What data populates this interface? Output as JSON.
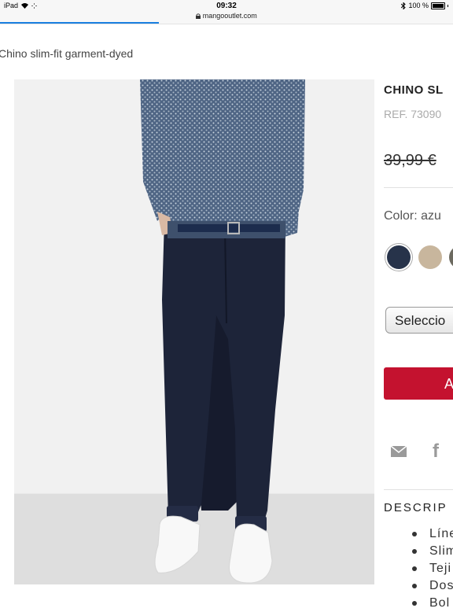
{
  "status_bar": {
    "device": "iPad",
    "time": "09:32",
    "url": "mangooutlet.com",
    "battery": "100 %",
    "load_progress": 0.35
  },
  "breadcrumb": "Chino slim-fit garment-dyed",
  "product": {
    "title": "CHINO SL",
    "ref": "REF. 73090",
    "price": "39,99 € ",
    "color_label": "Color: azu",
    "swatches": [
      "#27334a",
      "#c8b69d",
      "#6c6a60"
    ],
    "size_select": "Seleccio",
    "add_button": "A",
    "share_icons": [
      "mail-icon",
      "facebook-icon"
    ]
  },
  "description": {
    "title": "DESCRIP",
    "items": [
      "Líne",
      "Slim",
      "Teji",
      "Dos",
      "Bol"
    ]
  },
  "colors": {
    "accent": "#c4122f",
    "progress": "#1a7fe0",
    "pants": "#1b2136",
    "sweater": "#5a6f8e"
  }
}
